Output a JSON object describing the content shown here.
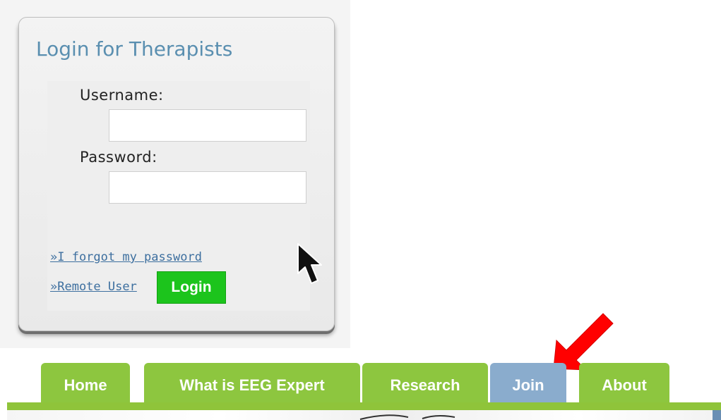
{
  "login": {
    "title": "Login for Therapists",
    "username_label": "Username:",
    "username_value": "",
    "password_label": "Password:",
    "password_value": "",
    "login_button": "Login",
    "forgot_link": "»I forgot my password",
    "remote_link": "»Remote User"
  },
  "nav": {
    "tabs": [
      {
        "label": "Home"
      },
      {
        "label": "What is EEG Expert"
      },
      {
        "label": "Research"
      },
      {
        "label": "Join"
      },
      {
        "label": "About"
      }
    ],
    "active_tab": "Join"
  },
  "icons": {
    "cursor": "mouse-pointer-icon",
    "annotation": "red-arrow-icon"
  },
  "colors": {
    "nav_green": "#8dc63f",
    "nav_active": "#8aaccd",
    "login_button": "#1cc41c",
    "title_blue": "#5a8fb0",
    "link_blue": "#3d6f9f",
    "annotation_red": "#ff0000"
  }
}
